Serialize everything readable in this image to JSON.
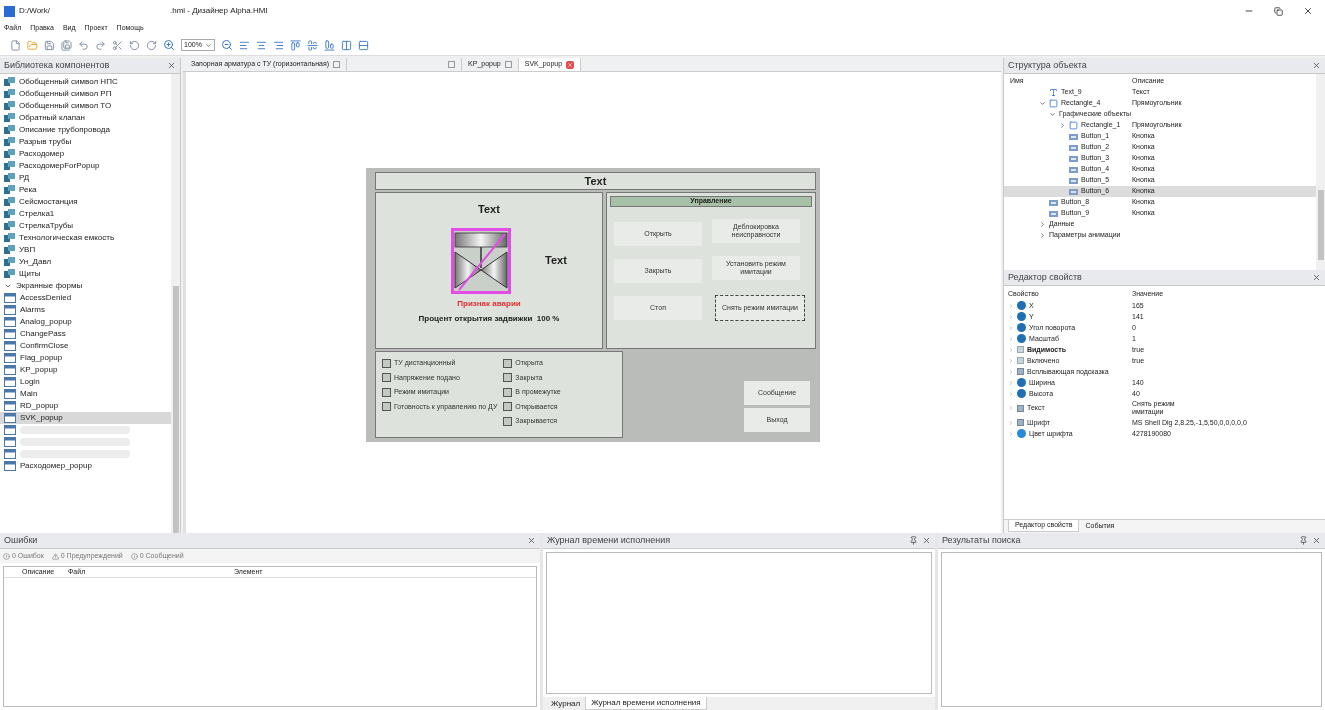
{
  "window": {
    "title_path": "D:/Work/",
    "title_rest": ".hmi - Дизайнер Alpha.HMI"
  },
  "menu": [
    "Файл",
    "Правка",
    "Вид",
    "Проект",
    "Помощь"
  ],
  "toolbar": {
    "zoom": "100%"
  },
  "library": {
    "title": "Библиотека компонентов",
    "items": [
      {
        "label": "Обобщенный символ НПС",
        "kind": "symbol",
        "selected": false
      },
      {
        "label": "Обобщенный символ РП",
        "kind": "symbol",
        "selected": false
      },
      {
        "label": "Обобщенный символ ТО",
        "kind": "symbol",
        "selected": false
      },
      {
        "label": "Обратный клапан",
        "kind": "symbol",
        "selected": false
      },
      {
        "label": "Описание трубопровода",
        "kind": "symbol",
        "selected": false
      },
      {
        "label": "Разрыв трубы",
        "kind": "symbol",
        "selected": false
      },
      {
        "label": "Расходомер",
        "kind": "symbol",
        "selected": false
      },
      {
        "label": "РасходомерForPopup",
        "kind": "symbol",
        "selected": false
      },
      {
        "label": "РД",
        "kind": "symbol",
        "selected": false
      },
      {
        "label": "Река",
        "kind": "symbol",
        "selected": false
      },
      {
        "label": "Сейсмостанция",
        "kind": "symbol",
        "selected": false
      },
      {
        "label": "Стрелка1",
        "kind": "symbol",
        "selected": false
      },
      {
        "label": "СтрелкаТрубы",
        "kind": "symbol",
        "selected": false
      },
      {
        "label": "Технологическая емкость",
        "kind": "symbol",
        "selected": false
      },
      {
        "label": "УВП",
        "kind": "symbol",
        "selected": false
      },
      {
        "label": "Ун_Давл",
        "kind": "symbol",
        "selected": false
      },
      {
        "label": "Щиты",
        "kind": "symbol",
        "selected": false
      },
      {
        "label": "Экранные формы",
        "kind": "group",
        "selected": false
      },
      {
        "label": "AccessDenied",
        "kind": "form",
        "selected": false
      },
      {
        "label": "Alarms",
        "kind": "form",
        "selected": false
      },
      {
        "label": "Analog_popup",
        "kind": "form",
        "selected": false
      },
      {
        "label": "ChangePass",
        "kind": "form",
        "selected": false
      },
      {
        "label": "ConfirmClose",
        "kind": "form",
        "selected": false
      },
      {
        "label": "Flag_popup",
        "kind": "form",
        "selected": false
      },
      {
        "label": "KP_popup",
        "kind": "form",
        "selected": false
      },
      {
        "label": "Login",
        "kind": "form",
        "selected": false
      },
      {
        "label": "Main",
        "kind": "form",
        "selected": false
      },
      {
        "label": "RD_popup",
        "kind": "form",
        "selected": false
      },
      {
        "label": "SVK_popup",
        "kind": "form",
        "selected": true
      },
      {
        "kind": "form",
        "selected": false
      },
      {
        "kind": "form",
        "selected": false
      },
      {
        "kind": "form",
        "selected": false
      },
      {
        "label": "Расходомер_popup",
        "kind": "form",
        "selected": false
      }
    ]
  },
  "doc_tabs": [
    {
      "label": "Запорная арматура с ТУ (горизонтальная)",
      "selected": false
    },
    {
      "selected": false
    },
    {
      "label": "KP_popup",
      "selected": false
    },
    {
      "label": "SVK_popup",
      "selected": true
    }
  ],
  "form": {
    "title": "Text",
    "left_title": "Text",
    "side_text": "Text",
    "alarm": "Признак аварии",
    "percent": "Процент открытия задвижки  100 %",
    "control_header": "Управление",
    "buttons": [
      {
        "label": "Открыть",
        "selected": false
      },
      {
        "label": "Закрыть",
        "selected": false
      },
      {
        "label": "Стоп",
        "selected": false
      },
      {
        "label": "Деблокировка неисправности",
        "selected": false
      },
      {
        "label": "Установить режим имитации",
        "selected": false
      },
      {
        "label": "Снять режим имитации",
        "selected": true
      }
    ],
    "flags_left": [
      {
        "label": "ТУ дистанционный",
        "checked": false
      },
      {
        "label": "Напряжение подано",
        "checked": false
      },
      {
        "label": "Режим имитации",
        "checked": false
      },
      {
        "label": "Готовность к управлению по ДУ",
        "checked": false
      }
    ],
    "flags_right": [
      {
        "label": "Открыта",
        "checked": false
      },
      {
        "label": "Закрыта",
        "checked": false
      },
      {
        "label": "В промежутке",
        "checked": false
      },
      {
        "label": "Открывается",
        "checked": false
      },
      {
        "label": "Закрывается",
        "checked": false
      }
    ],
    "bottom_buttons": [
      "Сообщение",
      "Выход"
    ]
  },
  "structure": {
    "title": "Структура объекта",
    "columns": [
      "Имя",
      "Описание"
    ],
    "items": [
      {
        "name": "Text_9",
        "description": "Текст",
        "kind": "text",
        "selected": false
      },
      {
        "name": "Rectangle_4",
        "description": "Прямоугольник",
        "kind": "rect",
        "expanded": true,
        "selected": false,
        "children": [
          {
            "name": "Графические объекты",
            "expanded": true,
            "selected": false,
            "children": [
              {
                "name": "Rectangle_1",
                "description": "Прямоугольник",
                "kind": "rect",
                "expanded": false,
                "selected": false
              },
              {
                "name": "Button_1",
                "description": "Кнопка",
                "kind": "button",
                "selected": false
              },
              {
                "name": "Button_2",
                "description": "Кнопка",
                "kind": "button",
                "selected": false
              },
              {
                "name": "Button_3",
                "description": "Кнопка",
                "kind": "button",
                "selected": false
              },
              {
                "name": "Button_4",
                "description": "Кнопка",
                "kind": "button",
                "selected": false
              },
              {
                "name": "Button_5",
                "description": "Кнопка",
                "kind": "button",
                "selected": false
              },
              {
                "name": "Button_6",
                "description": "Кнопка",
                "kind": "button",
                "selected": true
              }
            ]
          }
        ]
      },
      {
        "name": "Button_8",
        "description": "Кнопка",
        "kind": "button",
        "selected": false
      },
      {
        "name": "Button_9",
        "description": "Кнопка",
        "kind": "button",
        "selected": false
      },
      {
        "name": "Данные",
        "expanded": false,
        "selected": false
      },
      {
        "name": "Параметры анимации",
        "expanded": false,
        "selected": false
      }
    ]
  },
  "properties": {
    "title": "Редактор свойств",
    "columns": [
      "Свойство",
      "Значение"
    ],
    "rows": [
      {
        "name": "X",
        "value": "165",
        "kind": "number"
      },
      {
        "name": "Y",
        "value": "141",
        "kind": "number"
      },
      {
        "name": "Угол поворота",
        "value": "0",
        "kind": "number"
      },
      {
        "name": "Масштаб",
        "value": "1",
        "kind": "number"
      },
      {
        "name": "Видимость",
        "value": "true",
        "kind": "bool",
        "bold": true
      },
      {
        "name": "Включено",
        "value": "true",
        "kind": "bool"
      },
      {
        "name": "Всплывающая подсказка",
        "kind": "string"
      },
      {
        "name": "Ширина",
        "value": "140",
        "kind": "number"
      },
      {
        "name": "Высота",
        "value": "40",
        "kind": "number"
      },
      {
        "name": "Текст",
        "value": "Снять режим\nимитации",
        "kind": "string"
      },
      {
        "name": "Шрифт",
        "value": "MS Shell Dlg 2,8.25,-1,5,50,0,0,0,0,0",
        "kind": "string"
      },
      {
        "name": "Цвет шрифта",
        "value": "4278190080",
        "kind": "color"
      }
    ],
    "tabs": [
      {
        "label": "Редактор свойств",
        "selected": true
      },
      {
        "label": "События",
        "selected": false
      }
    ]
  },
  "errors": {
    "title": "Ошибки",
    "filters": [
      "0 Ошибок",
      "0 Предупреждений",
      "0 Сообщений"
    ],
    "columns": [
      "Описание",
      "Файл",
      "Элемент"
    ]
  },
  "runtime_log": {
    "title": "Журнал времени исполнения",
    "tabs": [
      {
        "label": "Журнал",
        "selected": false
      },
      {
        "label": "Журнал времени исполнения",
        "selected": true
      }
    ]
  },
  "search_results": {
    "title": "Результаты поиска"
  }
}
